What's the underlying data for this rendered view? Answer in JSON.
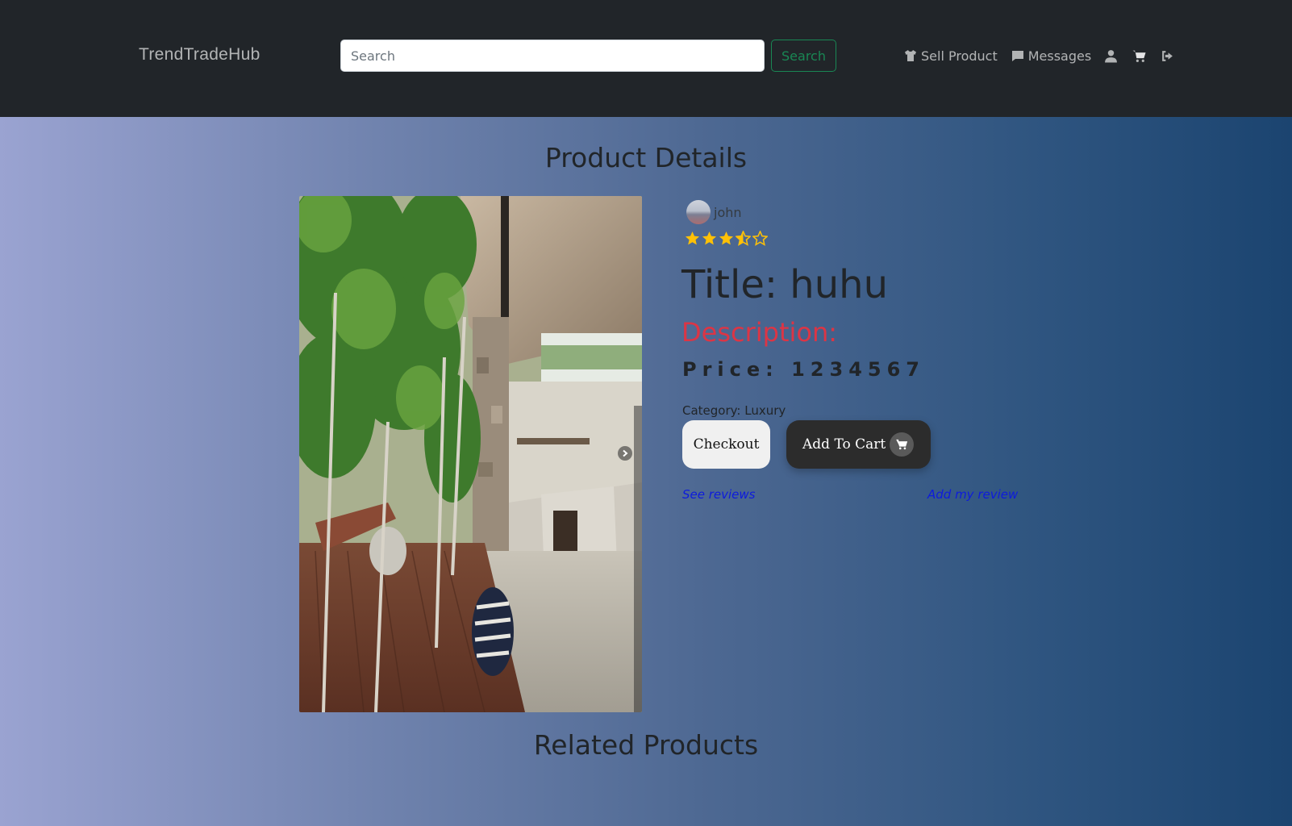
{
  "navbar": {
    "brand": "TrendTradeHub",
    "search_placeholder": "Search",
    "search_button": "Search",
    "links": {
      "sell_product": "Sell Product",
      "messages": "Messages"
    },
    "icons": [
      "shirt-icon",
      "message-icon",
      "user-icon",
      "cart-icon",
      "logout-icon"
    ]
  },
  "main": {
    "section_title": "Product Details",
    "seller": {
      "name": "john"
    },
    "rating": {
      "value": 3.5,
      "max": 5,
      "color": "#ffc107"
    },
    "title": "Title: huhu",
    "description_label": "Description:",
    "price": "Price: 1234567",
    "category": "Category: Luxury",
    "checkout_button": "Checkout",
    "add_to_cart_button": "Add To Cart",
    "see_reviews": "See reviews",
    "add_review": "Add my review"
  },
  "related": {
    "section_title": "Related Products"
  },
  "colors": {
    "navbar_bg": "#212529",
    "search_button": "#198754",
    "description": "#dc3545",
    "links": "#0d1bdc",
    "cart_button": "#2c2c2c"
  }
}
